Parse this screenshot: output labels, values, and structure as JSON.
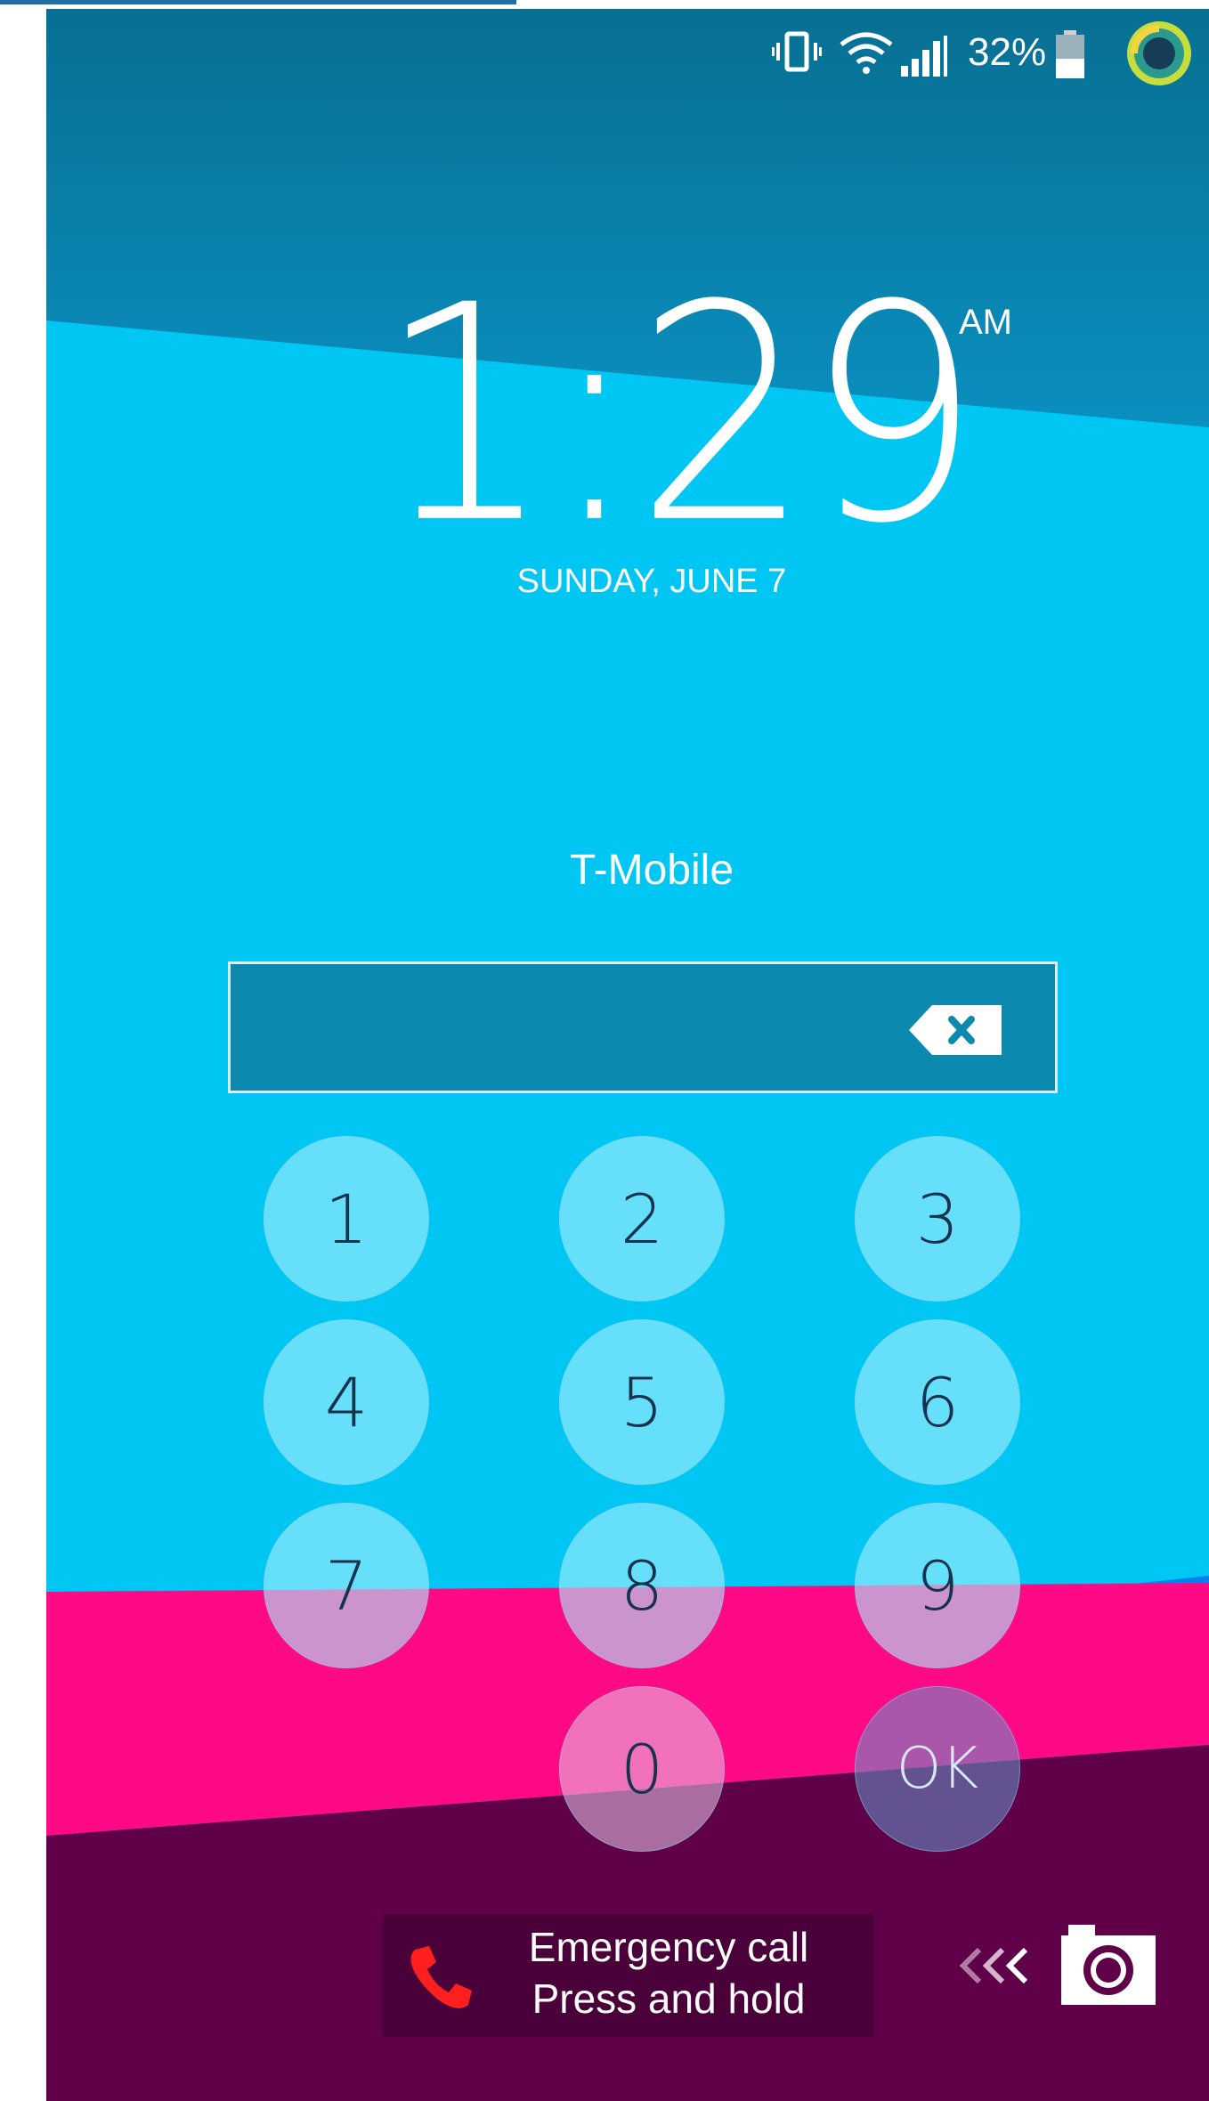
{
  "status_bar": {
    "battery_percent": "32%",
    "icons": [
      "vibrate-icon",
      "wifi-icon",
      "signal-icon",
      "battery-icon",
      "app-notification-icon"
    ]
  },
  "lockscreen": {
    "time": "1:29",
    "ampm": "AM",
    "date": "SUNDAY, JUNE 7",
    "carrier": "T-Mobile"
  },
  "pin_entry": {
    "value": "",
    "placeholder": ""
  },
  "keypad": {
    "keys": [
      "1",
      "2",
      "3",
      "4",
      "5",
      "6",
      "7",
      "8",
      "9",
      "0",
      "OK"
    ]
  },
  "emergency": {
    "line1": "Emergency call",
    "line2": "Press and hold"
  },
  "colors": {
    "sky_top": "#0a6f96",
    "sky_light": "#00c8f5",
    "blue_band": "#0a80f0",
    "pink_band": "#ff0a86",
    "purple_band": "#5f0049",
    "emergency_phone": "#ff1f1f"
  }
}
